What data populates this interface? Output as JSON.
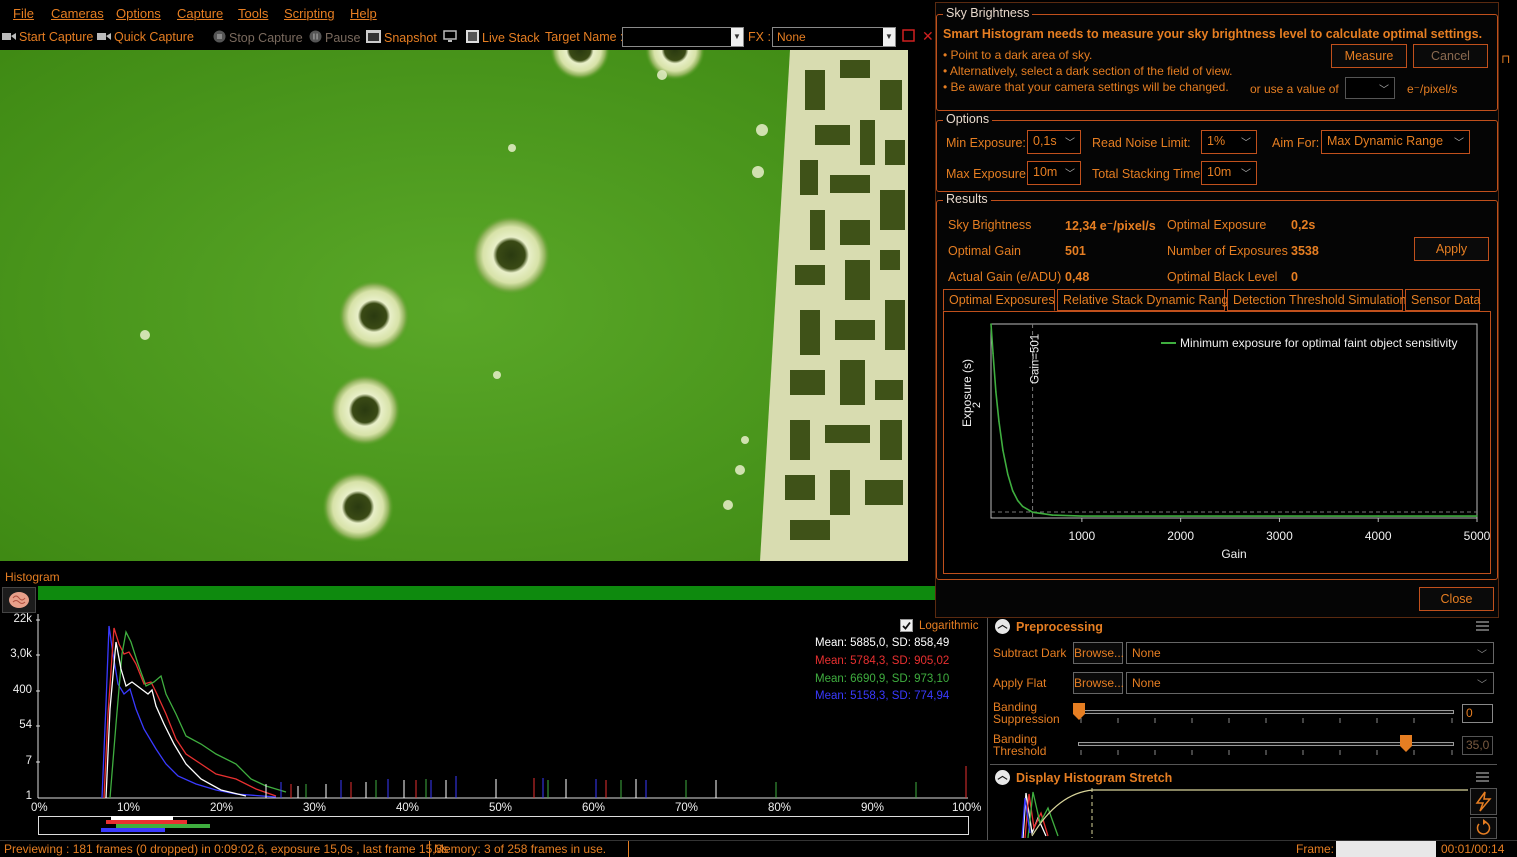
{
  "menu": [
    "File",
    "Cameras",
    "Options",
    "Capture",
    "Tools",
    "Scripting",
    "Help"
  ],
  "toolbar": {
    "start_capture": "Start Capture",
    "quick_capture": "Quick Capture",
    "stop_capture": "Stop Capture",
    "pause": "Pause",
    "snapshot": "Snapshot",
    "live_stack": "Live Stack",
    "target_name_label": "Target Name :",
    "target_name_value": "",
    "fx_label": "FX :",
    "fx_value": "None"
  },
  "histogram": {
    "title": "Histogram",
    "logarithmic_label": "Logarithmic",
    "logarithmic_checked": true,
    "y_ticks": [
      "22k",
      "3,0k",
      "400",
      "54",
      "7",
      "1"
    ],
    "x_ticks": [
      "0%",
      "10%",
      "20%",
      "30%",
      "40%",
      "50%",
      "60%",
      "70%",
      "80%",
      "90%",
      "100%"
    ],
    "stats": [
      {
        "text": "Mean: 5885,0, SD: 858,49",
        "color": "#ffffff"
      },
      {
        "text": "Mean: 5784,3, SD: 905,02",
        "color": "#e83030"
      },
      {
        "text": "Mean: 6690,9, SD: 973,10",
        "color": "#3fae3f"
      },
      {
        "text": "Mean: 5158,3, SD: 774,94",
        "color": "#3a3aff"
      }
    ]
  },
  "status": {
    "previewing": "Previewing : 181 frames (0 dropped) in 0:09:02,6, exposure 15,0s , last frame 15,3s",
    "memory": "Memory: 3 of 258 frames in use.",
    "frame_label": "Frame:",
    "time": "00:01/00:14"
  },
  "dialog": {
    "sky_brightness_group": "Sky Brightness",
    "heading": "Smart Histogram needs to measure your sky brightness level to calculate optimal settings.",
    "bullets": [
      "• Point to a dark area of sky.",
      "• Alternatively, select a dark section of the field of view.",
      "• Be aware that your camera settings will be changed."
    ],
    "measure": "Measure",
    "cancel": "Cancel",
    "or_use_value": "or use a value of",
    "unit": "e⁻/pixel/s",
    "options_group": "Options",
    "min_exposure_label": "Min Exposure:",
    "min_exposure_value": "0,1s",
    "read_noise_label": "Read Noise Limit:",
    "read_noise_value": "1%",
    "aim_for_label": "Aim For:",
    "aim_for_value": "Max Dynamic Range",
    "max_exposure_label": "Max Exposure:",
    "max_exposure_value": "10m",
    "total_stacking_label": "Total Stacking Time:",
    "total_stacking_value": "10m",
    "results_group": "Results",
    "results": {
      "sky_brightness_label": "Sky Brightness",
      "sky_brightness_value": "12,34 e⁻/pixel/s",
      "optimal_exposure_label": "Optimal Exposure",
      "optimal_exposure_value": "0,2s",
      "optimal_gain_label": "Optimal Gain",
      "optimal_gain_value": "501",
      "num_exposures_label": "Number of Exposures",
      "num_exposures_value": "3538",
      "actual_gain_label": "Actual Gain (e/ADU)",
      "actual_gain_value": "0,48",
      "optimal_black_label": "Optimal Black Level",
      "optimal_black_value": "0",
      "apply": "Apply"
    },
    "tabs": [
      "Optimal Exposures",
      "Relative Stack Dynamic Range",
      "Detection Threshold Simulation",
      "Sensor Data"
    ],
    "close": "Close"
  },
  "chart_data": {
    "type": "line",
    "xlabel": "Gain",
    "ylabel": "Exposure (s)",
    "x_ticks": [
      1000,
      2000,
      3000,
      4000,
      5000
    ],
    "y_tick_label": "2",
    "xlim": [
      80,
      5000
    ],
    "legend": "top-right",
    "series": [
      {
        "name": "Minimum exposure for optimal faint object sensitivity",
        "color": "#3fae3f",
        "x": [
          80,
          100,
          130,
          160,
          200,
          250,
          300,
          350,
          400,
          500,
          700,
          1000,
          2000,
          3000,
          4000,
          5000
        ],
        "y": [
          20,
          17,
          13,
          10,
          7,
          4.5,
          2.8,
          1.8,
          1.2,
          0.6,
          0.3,
          0.2,
          0.2,
          0.2,
          0.2,
          0.2
        ]
      }
    ],
    "marker": {
      "x": 501,
      "label": "Gain=501"
    }
  },
  "preprocessing": {
    "title": "Preprocessing",
    "subtract_dark": "Subtract Dark",
    "apply_flat": "Apply Flat",
    "browse": "Browse...",
    "none": "None",
    "banding_suppression": "Banding Suppression",
    "banding_suppression_value": "0",
    "banding_threshold": "Banding Threshold",
    "banding_threshold_value": "35,0"
  },
  "display_stretch": {
    "title": "Display Histogram Stretch"
  },
  "colors": {
    "accent": "#e67e22",
    "border": "#c0501c",
    "background": "#000000",
    "histogram_bar": "#0e8a0e"
  }
}
